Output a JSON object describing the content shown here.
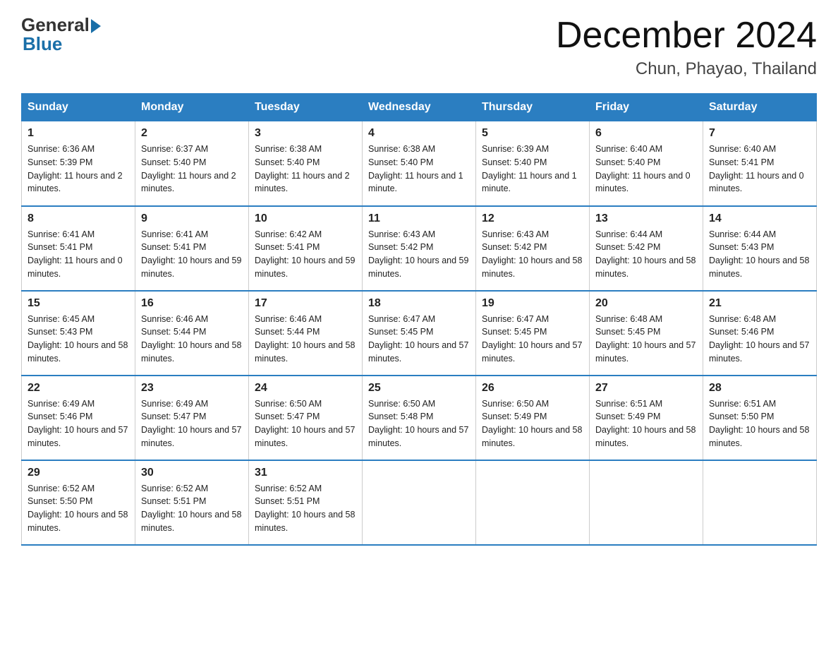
{
  "logo": {
    "general": "General",
    "blue": "Blue"
  },
  "header": {
    "month": "December 2024",
    "location": "Chun, Phayao, Thailand"
  },
  "days_of_week": [
    "Sunday",
    "Monday",
    "Tuesday",
    "Wednesday",
    "Thursday",
    "Friday",
    "Saturday"
  ],
  "weeks": [
    [
      {
        "day": "1",
        "sunrise": "6:36 AM",
        "sunset": "5:39 PM",
        "daylight": "11 hours and 2 minutes."
      },
      {
        "day": "2",
        "sunrise": "6:37 AM",
        "sunset": "5:40 PM",
        "daylight": "11 hours and 2 minutes."
      },
      {
        "day": "3",
        "sunrise": "6:38 AM",
        "sunset": "5:40 PM",
        "daylight": "11 hours and 2 minutes."
      },
      {
        "day": "4",
        "sunrise": "6:38 AM",
        "sunset": "5:40 PM",
        "daylight": "11 hours and 1 minute."
      },
      {
        "day": "5",
        "sunrise": "6:39 AM",
        "sunset": "5:40 PM",
        "daylight": "11 hours and 1 minute."
      },
      {
        "day": "6",
        "sunrise": "6:40 AM",
        "sunset": "5:40 PM",
        "daylight": "11 hours and 0 minutes."
      },
      {
        "day": "7",
        "sunrise": "6:40 AM",
        "sunset": "5:41 PM",
        "daylight": "11 hours and 0 minutes."
      }
    ],
    [
      {
        "day": "8",
        "sunrise": "6:41 AM",
        "sunset": "5:41 PM",
        "daylight": "11 hours and 0 minutes."
      },
      {
        "day": "9",
        "sunrise": "6:41 AM",
        "sunset": "5:41 PM",
        "daylight": "10 hours and 59 minutes."
      },
      {
        "day": "10",
        "sunrise": "6:42 AM",
        "sunset": "5:41 PM",
        "daylight": "10 hours and 59 minutes."
      },
      {
        "day": "11",
        "sunrise": "6:43 AM",
        "sunset": "5:42 PM",
        "daylight": "10 hours and 59 minutes."
      },
      {
        "day": "12",
        "sunrise": "6:43 AM",
        "sunset": "5:42 PM",
        "daylight": "10 hours and 58 minutes."
      },
      {
        "day": "13",
        "sunrise": "6:44 AM",
        "sunset": "5:42 PM",
        "daylight": "10 hours and 58 minutes."
      },
      {
        "day": "14",
        "sunrise": "6:44 AM",
        "sunset": "5:43 PM",
        "daylight": "10 hours and 58 minutes."
      }
    ],
    [
      {
        "day": "15",
        "sunrise": "6:45 AM",
        "sunset": "5:43 PM",
        "daylight": "10 hours and 58 minutes."
      },
      {
        "day": "16",
        "sunrise": "6:46 AM",
        "sunset": "5:44 PM",
        "daylight": "10 hours and 58 minutes."
      },
      {
        "day": "17",
        "sunrise": "6:46 AM",
        "sunset": "5:44 PM",
        "daylight": "10 hours and 58 minutes."
      },
      {
        "day": "18",
        "sunrise": "6:47 AM",
        "sunset": "5:45 PM",
        "daylight": "10 hours and 57 minutes."
      },
      {
        "day": "19",
        "sunrise": "6:47 AM",
        "sunset": "5:45 PM",
        "daylight": "10 hours and 57 minutes."
      },
      {
        "day": "20",
        "sunrise": "6:48 AM",
        "sunset": "5:45 PM",
        "daylight": "10 hours and 57 minutes."
      },
      {
        "day": "21",
        "sunrise": "6:48 AM",
        "sunset": "5:46 PM",
        "daylight": "10 hours and 57 minutes."
      }
    ],
    [
      {
        "day": "22",
        "sunrise": "6:49 AM",
        "sunset": "5:46 PM",
        "daylight": "10 hours and 57 minutes."
      },
      {
        "day": "23",
        "sunrise": "6:49 AM",
        "sunset": "5:47 PM",
        "daylight": "10 hours and 57 minutes."
      },
      {
        "day": "24",
        "sunrise": "6:50 AM",
        "sunset": "5:47 PM",
        "daylight": "10 hours and 57 minutes."
      },
      {
        "day": "25",
        "sunrise": "6:50 AM",
        "sunset": "5:48 PM",
        "daylight": "10 hours and 57 minutes."
      },
      {
        "day": "26",
        "sunrise": "6:50 AM",
        "sunset": "5:49 PM",
        "daylight": "10 hours and 58 minutes."
      },
      {
        "day": "27",
        "sunrise": "6:51 AM",
        "sunset": "5:49 PM",
        "daylight": "10 hours and 58 minutes."
      },
      {
        "day": "28",
        "sunrise": "6:51 AM",
        "sunset": "5:50 PM",
        "daylight": "10 hours and 58 minutes."
      }
    ],
    [
      {
        "day": "29",
        "sunrise": "6:52 AM",
        "sunset": "5:50 PM",
        "daylight": "10 hours and 58 minutes."
      },
      {
        "day": "30",
        "sunrise": "6:52 AM",
        "sunset": "5:51 PM",
        "daylight": "10 hours and 58 minutes."
      },
      {
        "day": "31",
        "sunrise": "6:52 AM",
        "sunset": "5:51 PM",
        "daylight": "10 hours and 58 minutes."
      },
      null,
      null,
      null,
      null
    ]
  ]
}
